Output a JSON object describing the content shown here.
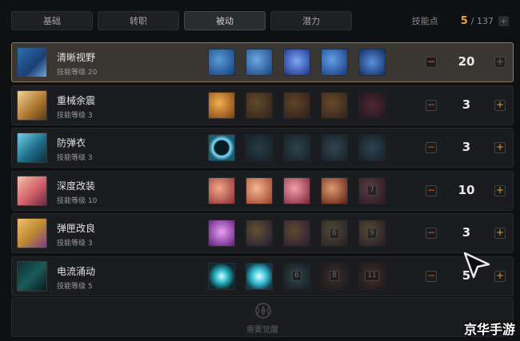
{
  "tabs": [
    {
      "label": "基础",
      "active": false
    },
    {
      "label": "转职",
      "active": false
    },
    {
      "label": "被动",
      "active": true
    },
    {
      "label": "潜力",
      "active": false
    }
  ],
  "skill_points": {
    "label": "技能点",
    "current": "5",
    "total": "/ 137"
  },
  "skills": [
    {
      "name": "清晰视野",
      "level_text": "技能等级 20",
      "value": "20",
      "selected": true,
      "sub_icons": [
        {
          "label": ""
        },
        {
          "label": ""
        },
        {
          "label": ""
        },
        {
          "label": ""
        },
        {
          "label": ""
        }
      ]
    },
    {
      "name": "重械余震",
      "level_text": "技能等级 3",
      "value": "3",
      "selected": false,
      "sub_icons": [
        {
          "label": ""
        },
        {
          "label": ""
        },
        {
          "label": ""
        },
        {
          "label": ""
        },
        {
          "label": ""
        }
      ]
    },
    {
      "name": "防弹衣",
      "level_text": "技能等级 3",
      "value": "3",
      "selected": false,
      "sub_icons": [
        {
          "label": ""
        },
        {
          "label": ""
        },
        {
          "label": ""
        },
        {
          "label": ""
        },
        {
          "label": ""
        }
      ]
    },
    {
      "name": "深度改装",
      "level_text": "技能等级 10",
      "value": "10",
      "selected": false,
      "sub_icons": [
        {
          "label": ""
        },
        {
          "label": ""
        },
        {
          "label": ""
        },
        {
          "label": ""
        },
        {
          "label": "7"
        }
      ]
    },
    {
      "name": "弹匣改良",
      "level_text": "技能等级 3",
      "value": "3",
      "selected": false,
      "sub_icons": [
        {
          "label": ""
        },
        {
          "label": ""
        },
        {
          "label": ""
        },
        {
          "label": "6"
        },
        {
          "label": "9"
        }
      ]
    },
    {
      "name": "电流涌动",
      "level_text": "技能等级 5",
      "value": "5",
      "selected": false,
      "sub_icons": [
        {
          "label": ""
        },
        {
          "label": ""
        },
        {
          "label": "6"
        },
        {
          "label": "8"
        },
        {
          "label": "11"
        }
      ]
    }
  ],
  "awaken": {
    "label": "需要觉醒"
  },
  "watermark": "京华手游",
  "colors": {
    "accent_orange": "#f0a048",
    "minus_red": "#d7572d",
    "selected_border": "#8d7c63"
  }
}
